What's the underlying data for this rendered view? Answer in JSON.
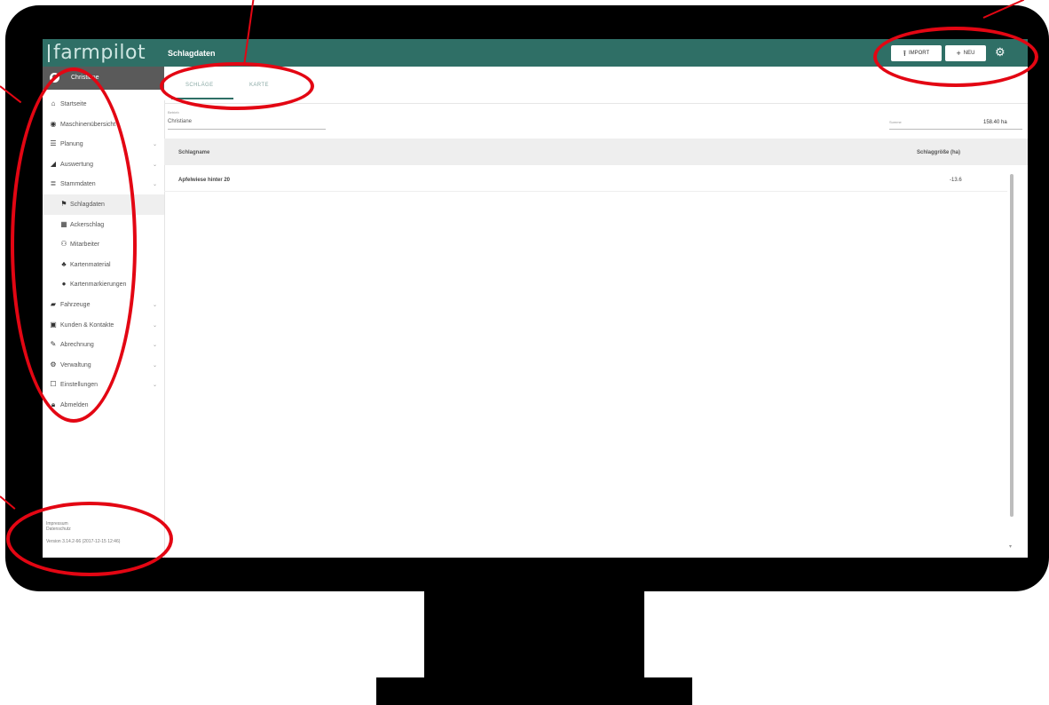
{
  "app": {
    "logo": "farmpilot"
  },
  "user": {
    "name": "Christiane"
  },
  "sidebar": {
    "items": [
      {
        "icon": "house-icon",
        "glyph": "⌂",
        "label": "Startseite",
        "sub": false,
        "chevron": false,
        "active": false
      },
      {
        "icon": "dashboard-icon",
        "glyph": "◉",
        "label": "Maschinenübersicht",
        "sub": false,
        "chevron": false,
        "active": false
      },
      {
        "icon": "list-icon",
        "glyph": "☰",
        "label": "Planung",
        "sub": false,
        "chevron": true,
        "active": false
      },
      {
        "icon": "chart-icon",
        "glyph": "◢",
        "label": "Auswertung",
        "sub": false,
        "chevron": true,
        "active": false
      },
      {
        "icon": "database-icon",
        "glyph": "≣",
        "label": "Stammdaten",
        "sub": false,
        "chevron": true,
        "active": false
      },
      {
        "icon": "flag-icon",
        "glyph": "⚑",
        "label": "Schlagdaten",
        "sub": true,
        "chevron": false,
        "active": true
      },
      {
        "icon": "calendar-icon",
        "glyph": "▦",
        "label": "Ackerschlag",
        "sub": true,
        "chevron": false,
        "active": false
      },
      {
        "icon": "people-icon",
        "glyph": "⚇",
        "label": "Mitarbeiter",
        "sub": true,
        "chevron": false,
        "active": false
      },
      {
        "icon": "tree-icon",
        "glyph": "♣",
        "label": "Kartenmaterial",
        "sub": true,
        "chevron": false,
        "active": false
      },
      {
        "icon": "pin-icon",
        "glyph": "●",
        "label": "Kartenmarkierungen",
        "sub": true,
        "chevron": false,
        "active": false
      },
      {
        "icon": "truck-icon",
        "glyph": "▰",
        "label": "Fahrzeuge",
        "sub": false,
        "chevron": true,
        "active": false
      },
      {
        "icon": "contacts-icon",
        "glyph": "▣",
        "label": "Kunden & Kontakte",
        "sub": false,
        "chevron": true,
        "active": false
      },
      {
        "icon": "wrench-icon",
        "glyph": "✎",
        "label": "Abrechnung",
        "sub": false,
        "chevron": true,
        "active": false
      },
      {
        "icon": "gear-icon",
        "glyph": "⚙",
        "label": "Verwaltung",
        "sub": false,
        "chevron": true,
        "active": false
      },
      {
        "icon": "settings-icon",
        "glyph": "☐",
        "label": "Einstellungen",
        "sub": false,
        "chevron": true,
        "active": false
      },
      {
        "icon": "lock-icon",
        "glyph": "🔒︎",
        "label": "Abmelden",
        "sub": false,
        "chevron": false,
        "active": false
      }
    ],
    "footer": {
      "line1": "Impressum",
      "line2": "Datenschutz",
      "version": "Version 3.14.2-66 (2017-12-15 12:46)"
    }
  },
  "header": {
    "title": "Schlagdaten",
    "import_label": "IMPORT",
    "neu_label": "NEU"
  },
  "tabs": [
    {
      "label": "SCHLÄGE"
    },
    {
      "label": "KARTE"
    }
  ],
  "filter": {
    "field_label": "Betrieb",
    "field_value": "Christiane",
    "sum_label": "Summe",
    "sum_value": "158.40 ha"
  },
  "table": {
    "headers": [
      "Schlagname",
      "Schlaggröße (ha)"
    ],
    "rows": [
      [
        "Apfelwiese hinter 20",
        "-13.6"
      ]
    ]
  }
}
